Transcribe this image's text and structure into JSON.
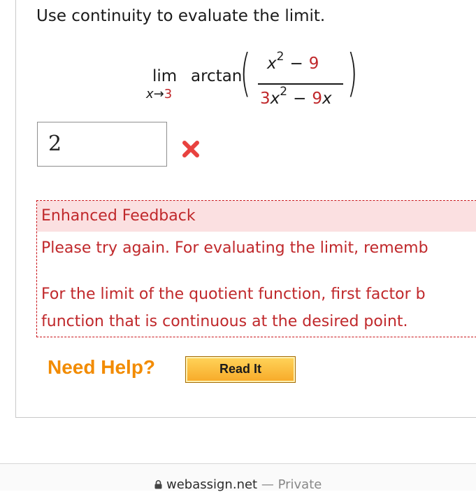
{
  "question": {
    "prompt": "Use continuity to evaluate the limit."
  },
  "expression": {
    "lim_word": "lim",
    "sub_var": "x",
    "sub_arrow": "→",
    "sub_value": "3",
    "func_name": "arctan",
    "numerator": {
      "var": "x",
      "exp": "2",
      "op": "−",
      "const": "9"
    },
    "denominator": {
      "coef": "3",
      "var": "x",
      "exp": "2",
      "op": "−",
      "term_coef": "9",
      "term_var": "x"
    }
  },
  "answer": {
    "value": "2",
    "status_icon": "red-x-icon"
  },
  "feedback": {
    "header": "Enhanced Feedback",
    "line1": "Please try again. For evaluating the limit, rememb",
    "line2": "For the limit of the quotient function, first factor b",
    "line3": "function that is continuous at the desired point."
  },
  "help": {
    "label": "Need Help?",
    "read_it": "Read It"
  },
  "browser": {
    "domain": "webassign.net",
    "separator": "—",
    "mode": "Private"
  },
  "colors": {
    "accent_red": "#c0282b",
    "help_orange": "#f28b00",
    "button_yellow": "#f7a928"
  }
}
